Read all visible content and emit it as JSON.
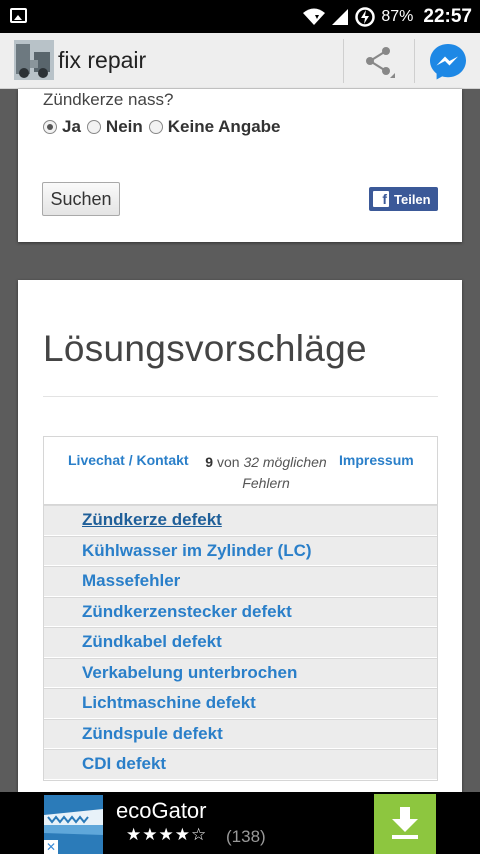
{
  "status_bar": {
    "battery_percent": "87%",
    "time": "22:57",
    "icons": [
      "image-icon",
      "wifi-icon",
      "signal-icon",
      "battery-charging-icon"
    ]
  },
  "app_bar": {
    "title": "fix repair",
    "actions": [
      "share-icon",
      "messenger-icon"
    ]
  },
  "form": {
    "question": "Zündkerze nass?",
    "options": [
      "Ja",
      "Nein",
      "Keine Angabe"
    ],
    "selected": "Ja",
    "search_label": "Suchen",
    "share_label": "Teilen",
    "share_icon_text": "f"
  },
  "solutions": {
    "title": "Lösungsvorschläge",
    "contact_link": "Livechat / Kontakt",
    "count_shown": "9",
    "count_of": "von",
    "count_total": "32 möglichen",
    "count_unit": "Fehlern",
    "imprint_link": "Impressum",
    "items": [
      "Zündkerze defekt",
      "Kühlwasser im Zylinder (LC)",
      "Massefehler",
      "Zündkerzenstecker defekt",
      "Zündkabel defekt",
      "Verkabelung unterbrochen",
      "Lichtmaschine defekt",
      "Zündspule defekt",
      "CDI defekt"
    ]
  },
  "ad": {
    "name": "ecoGator",
    "stars": "★★★★☆",
    "rating_count": "(138)",
    "close_mark": "✕",
    "accent": "#8dc63f"
  },
  "colors": {
    "link": "#2a7fc9",
    "facebook": "#3b5998",
    "messenger": "#1e88e5"
  }
}
